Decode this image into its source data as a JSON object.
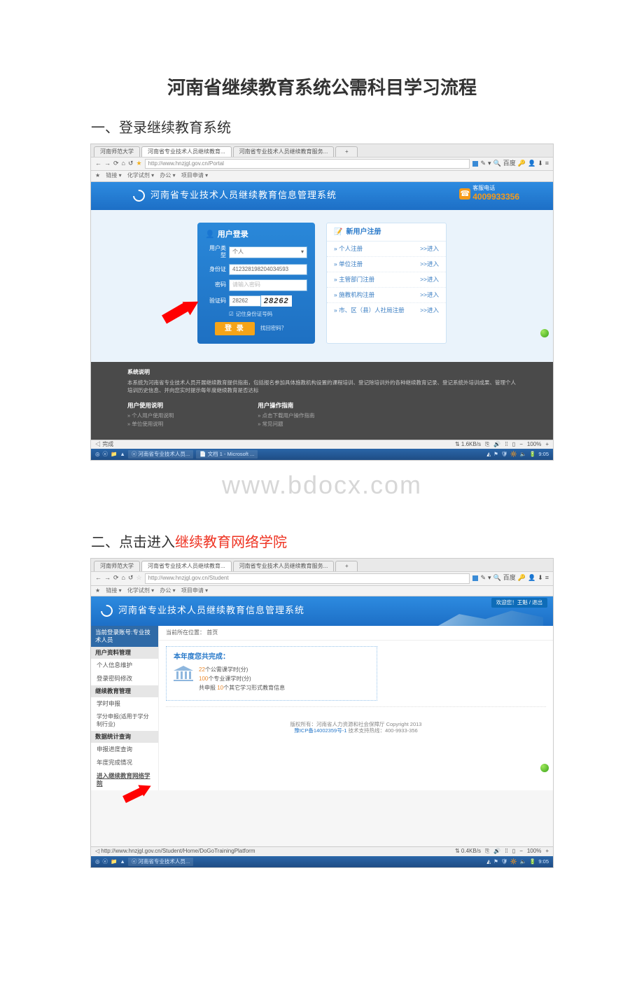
{
  "doc": {
    "title": "河南省继续教育系统公需科目学习流程",
    "section1": "一、登录继续教育系统",
    "section2_a": "二、点击进入",
    "section2_b": "继续教育网络学院"
  },
  "watermark": "www.bdocx.com",
  "tabs": {
    "t1": "河南师范大学",
    "t2": "河南省专业技术人员继续教育...",
    "t3": "河南省专业技术人员继续教育服务...",
    "add": "+"
  },
  "addr1": {
    "url": "http://www.hnzjgl.gov.cn/Portal",
    "search": "百度"
  },
  "addr2": {
    "url": "http://www.hnzjgl.gov.cn/Student",
    "search": "百度"
  },
  "bookmarks": {
    "b0": "链接 ▾",
    "b1": "化学试剂 ▾",
    "b2": "办公 ▾",
    "b3": "项目申请 ▾"
  },
  "shot1": {
    "banner_title": "河南省专业技术人员继续教育信息管理系统",
    "tel_label": "客服电话",
    "tel_num": "4009933356",
    "login": {
      "title": "用户登录",
      "type_label": "用户类型",
      "type_value": "个人",
      "id_label": "身份证",
      "id_value": "412328198204034593",
      "pwd_label": "密码",
      "pwd_placeholder": "请输入密码",
      "captcha_label": "验证码",
      "captcha_value": "28262",
      "captcha_img": "28262",
      "remember": "记住身份证号码",
      "login_btn": "登 录",
      "forgot": "找回密码？"
    },
    "register": {
      "title": "新用户注册",
      "go": ">>进入",
      "items": [
        "个人注册",
        "单位注册",
        "主管部门注册",
        "施教机构注册",
        "市、区（县）人社局注册"
      ]
    },
    "dark": {
      "sys_title": "系统说明",
      "sys_desc": "本系统为河南省专业技术人员开展继续教育提供指南，包括报名参加具体施教机构设置的课程培训、登记除培训外的各种继续教育记录、登记系统外培训成果、管理个人培训历史信息、并向您实时提示每年度继续教育是否达标",
      "col1_title": "用户使用说明",
      "col1_a": "» 个人用户使用说明",
      "col1_b": "» 单位使用说明",
      "col2_title": "用户操作指南",
      "col2_a": "» 点击下载用户操作指南",
      "col2_b": "» 常见问题"
    },
    "status": {
      "left": "完成",
      "speed": "⇅ 1.6KB/s",
      "zoom": "100%"
    },
    "taskbar": {
      "t1": "河南省专业技术人员...",
      "t2": "文档 1 - Microsoft ...",
      "time": "9:05"
    }
  },
  "shot2": {
    "banner_title": "河南省专业技术人员继续教育信息管理系统",
    "welcome": "欢迎您！王魁 / 退出",
    "sidebar": {
      "acct": "当前登录账号:专业技术人员",
      "cat1": "用户资料管理",
      "i1": "个人信息维护",
      "i2": "登录密码修改",
      "cat2": "继续教育管理",
      "i3": "学时申报",
      "i4": "学分申报(适用于学分制行业)",
      "cat3": "数据统计查询",
      "i5": "申报进度查询",
      "i6": "年度完成情况",
      "i7": "进入继续教育网络学院"
    },
    "crumb": "当前所在位置：  首页",
    "panel": {
      "title": "本年度您共完成：",
      "line1a": "22",
      "line1b": "个公需课学时(分)",
      "line2a": "100",
      "line2b": "个专业课学时(分)",
      "line3a": "共申报 ",
      "line3b": "10",
      "line3c": "个其它学习形式教育信息"
    },
    "footer": {
      "l1": "版权所有：河南省人力资源和社会保障厅 Copyright 2013",
      "icp": "豫ICP备14002359号-1",
      "l2": "   技术支持热线：400-9933-356"
    },
    "status": {
      "left": "http://www.hnzjgl.gov.cn/Student/Home/DoGoTrainingPlatform",
      "speed": "⇅ 0.4KB/s",
      "zoom": "100%"
    },
    "taskbar": {
      "t1": "河南省专业技术人员...",
      "time": "9:05"
    }
  }
}
